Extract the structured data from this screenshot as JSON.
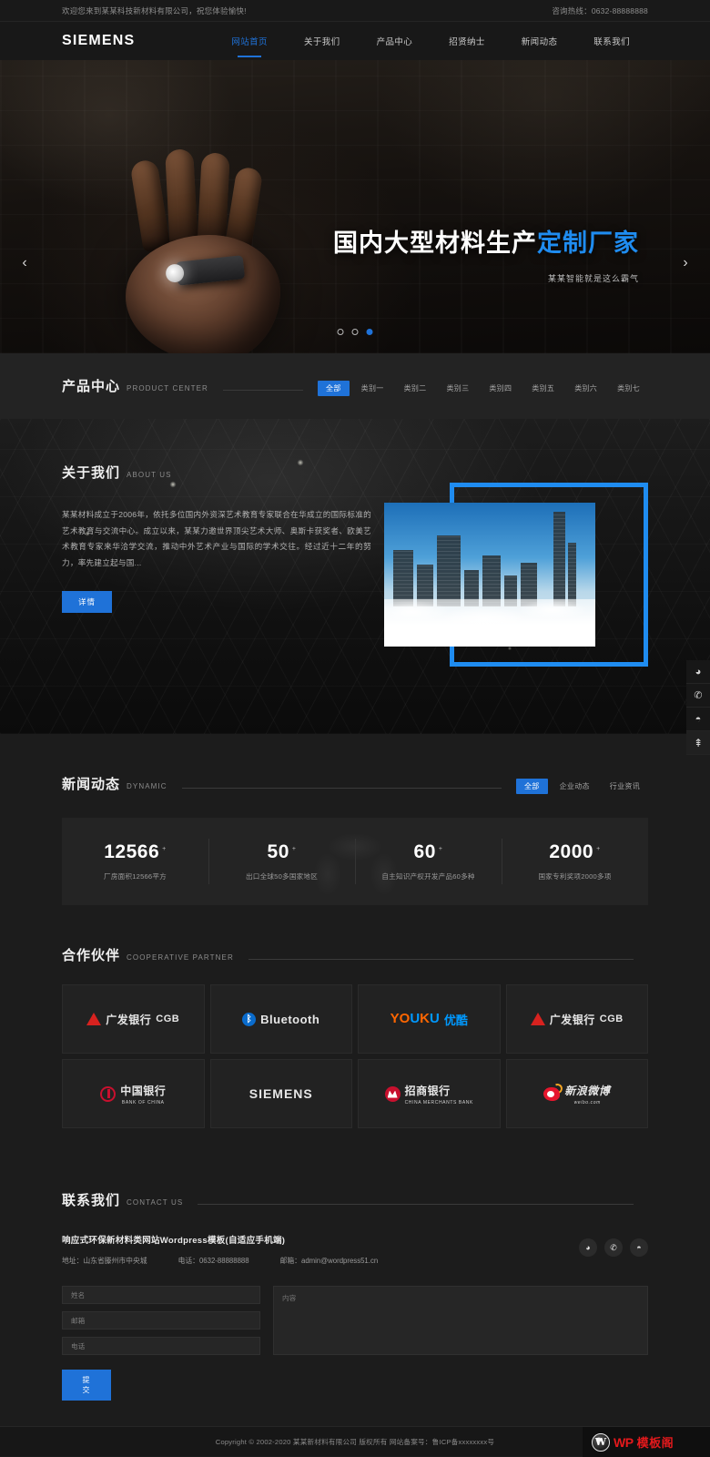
{
  "topbar": {
    "welcome": "欢迎您来到某某科技新材料有限公司，祝您体验愉快!",
    "hotline": "咨询热线：0632-88888888"
  },
  "header": {
    "logo": "SIEMENS",
    "nav": [
      {
        "label": "网站首页",
        "active": true
      },
      {
        "label": "关于我们",
        "active": false
      },
      {
        "label": "产品中心",
        "active": false
      },
      {
        "label": "招贤纳士",
        "active": false
      },
      {
        "label": "新闻动态",
        "active": false
      },
      {
        "label": "联系我们",
        "active": false
      }
    ]
  },
  "hero": {
    "title_main": "国内大型材料生产",
    "title_accent": "定制厂家",
    "subtitle": "某某智能就是这么霸气",
    "prev_icon": "chevron-left-icon",
    "next_icon": "chevron-right-icon",
    "slide_count": 3,
    "active_slide": 3
  },
  "product": {
    "title_cn": "产品中心",
    "title_en": "PRODUCT CENTER",
    "tabs": [
      "全部",
      "类别一",
      "类别二",
      "类别三",
      "类别四",
      "类别五",
      "类别六",
      "类别七"
    ],
    "active_tab": "全部"
  },
  "about": {
    "title_cn": "关于我们",
    "title_en": "ABOUT US",
    "paragraph": "某某材料成立于2006年，依托多位国内外资深艺术教育专家联合在华成立的国际标准的艺术教育与交流中心。成立以来，某某力邀世界顶尖艺术大师、奥斯卡获奖者、欧美艺术教育专家来华洽学交流，推动中外艺术产业与国际的学术交往。经过近十二年的努力，率先建立起与国...",
    "button": "详情"
  },
  "news": {
    "title_cn": "新闻动态",
    "title_en": "DYNAMIC",
    "tabs": [
      "全部",
      "企业动态",
      "行业资讯"
    ],
    "active_tab": "全部",
    "stats": [
      {
        "value": "12566",
        "suffix": "+",
        "label": "厂房面积12566平方"
      },
      {
        "value": "50",
        "suffix": "+",
        "label": "出口全球50多国家地区"
      },
      {
        "value": "60",
        "suffix": "+",
        "label": "自主知识产权开发产品60多种"
      },
      {
        "value": "2000",
        "suffix": "+",
        "label": "国家专利奖项2000多项"
      }
    ]
  },
  "partners": {
    "title_cn": "合作伙伴",
    "title_en": "COOPERATIVE PARTNER",
    "logos": [
      {
        "name": "广发银行",
        "en": "CGB",
        "mark": "cgb-triangle-icon"
      },
      {
        "name": "Bluetooth",
        "en": "",
        "mark": "bluetooth-icon"
      },
      {
        "name": "优酷",
        "en": "YOUKU",
        "mark": "youku-icon"
      },
      {
        "name": "广发银行",
        "en": "CGB",
        "mark": "cgb-triangle-icon"
      },
      {
        "name": "中国银行",
        "en": "BANK OF CHINA",
        "mark": "boc-icon"
      },
      {
        "name": "SIEMENS",
        "en": "",
        "mark": "siemens-icon"
      },
      {
        "name": "招商银行",
        "en": "CHINA MERCHANTS BANK",
        "mark": "cmb-icon"
      },
      {
        "name": "新浪微博",
        "en": "weibo.com",
        "mark": "weibo-icon"
      }
    ]
  },
  "contact": {
    "title_cn": "联系我们",
    "title_en": "CONTACT US",
    "company": "响应式环保新材料类网站Wordpress模板(自适应手机端)",
    "address": "地址：山东省滕州市中央城",
    "phone": "电话：0632-88888888",
    "email": "邮箱：admin@wordpress51.cn",
    "social": [
      "qq-icon",
      "phone-icon",
      "wechat-icon"
    ],
    "form": {
      "name_placeholder": "姓名",
      "email_placeholder": "邮箱",
      "phone_placeholder": "电话",
      "content_placeholder": "内容",
      "submit": "提交"
    }
  },
  "footer": {
    "copyright": "Copyright © 2002-2020 某某新材料有限公司 版权所有 网站备案号：鲁ICP备xxxxxxxx号",
    "badge_w": "WP",
    "badge_cn": "模板阁",
    "badge_icon": "wordpress-icon"
  },
  "floatbar": {
    "items": [
      {
        "icon": "qq-icon",
        "glyph": "◕"
      },
      {
        "icon": "phone-icon",
        "glyph": "✆"
      },
      {
        "icon": "wechat-icon",
        "glyph": "◓"
      },
      {
        "icon": "back-to-top-icon",
        "glyph": "⇞"
      }
    ]
  }
}
